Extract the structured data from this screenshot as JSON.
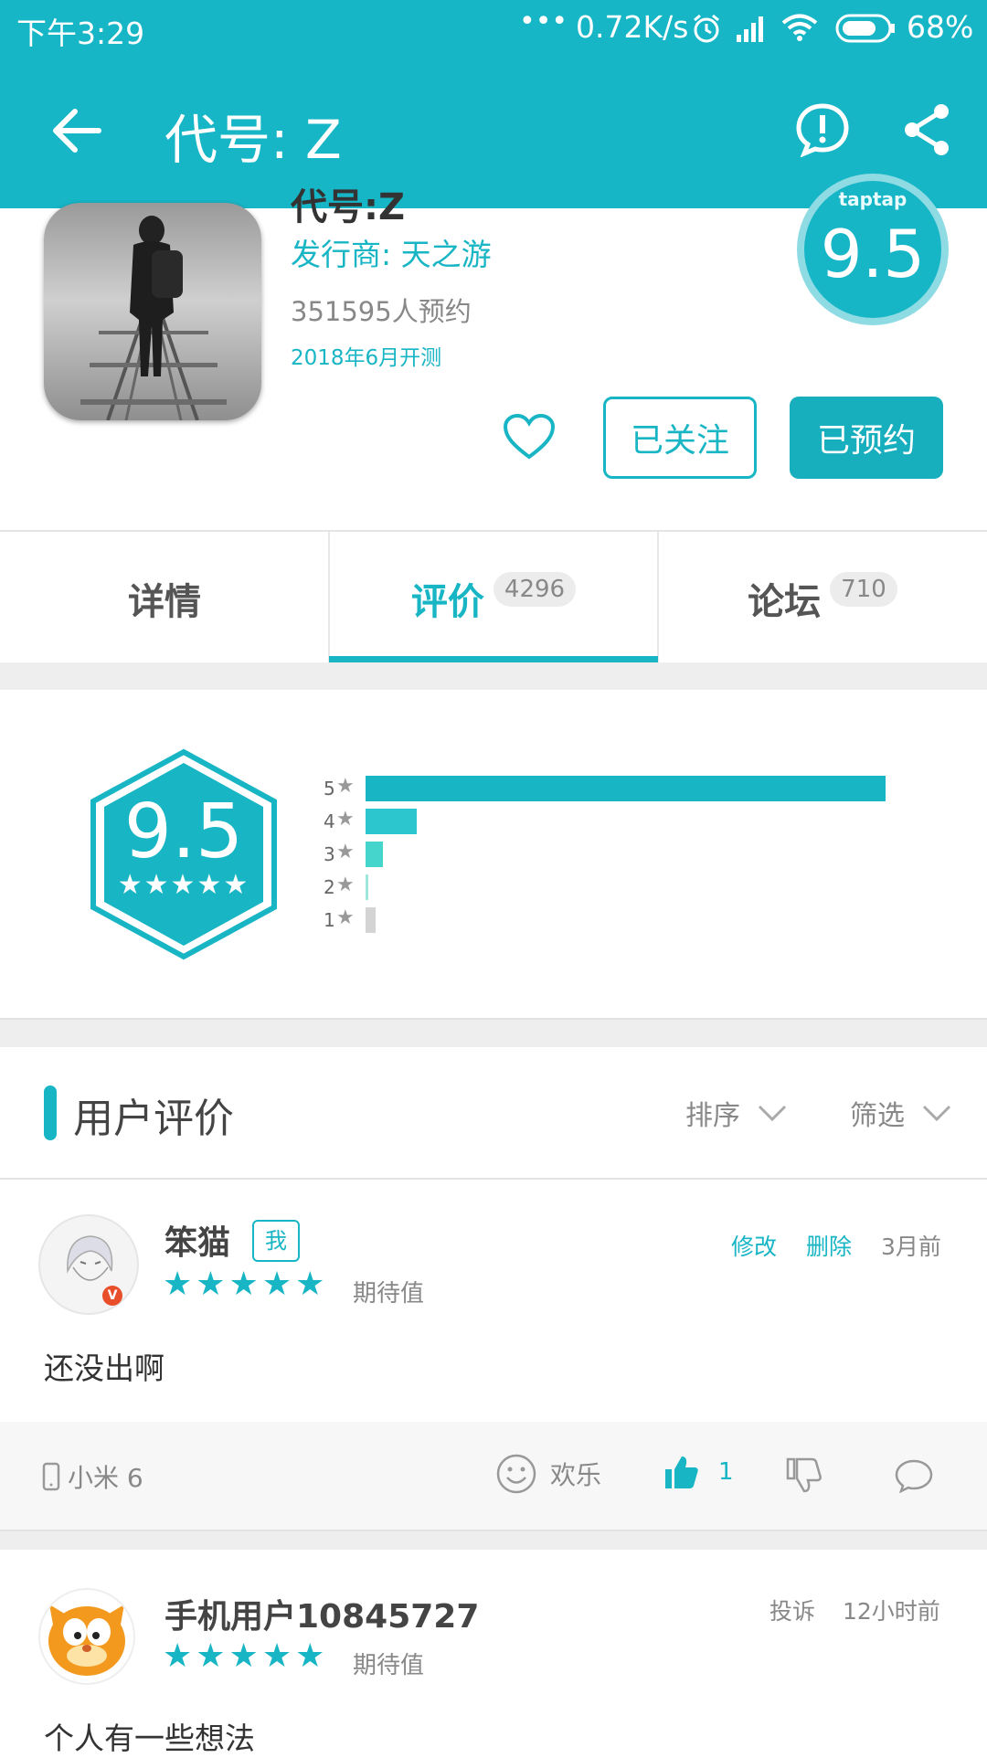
{
  "status_bar": {
    "time": "下午3:29",
    "dots": "•••",
    "speed": "0.72K/s",
    "battery": "68%"
  },
  "app_bar": {
    "title": "代号: Z",
    "icons": [
      "back-arrow-icon",
      "report-icon",
      "share-icon"
    ]
  },
  "game": {
    "name_partial": "代号:Z",
    "publisher": "发行商: 天之游",
    "reservations": "351595人预约",
    "test_date": "2018年6月开测",
    "badge_label": "taptap",
    "score": "9.5",
    "follow_label": "已关注",
    "reserved_label": "已预约"
  },
  "tabs": [
    {
      "label": "详情",
      "badge": ""
    },
    {
      "label": "评价",
      "badge": "4296"
    },
    {
      "label": "论坛",
      "badge": "710"
    }
  ],
  "rating": {
    "score": "9.5",
    "stars": "★★★★★",
    "distribution": [
      {
        "label": "5",
        "fraction": 0.91
      },
      {
        "label": "4",
        "fraction": 0.09
      },
      {
        "label": "3",
        "fraction": 0.03
      },
      {
        "label": "2",
        "fraction": 0.004
      },
      {
        "label": "1",
        "fraction": 0.018
      }
    ],
    "colors": {
      "5": "#18b5c5",
      "4": "#2cc6cf",
      "3": "#45d5cc",
      "2": "#9fe6dd",
      "1": "#d4d4d4"
    }
  },
  "reviews_section": {
    "title": "用户评价",
    "sort_label": "排序",
    "filter_label": "筛选"
  },
  "reviews": [
    {
      "user": "笨猫",
      "me_tag": "我",
      "edit": "修改",
      "delete": "删除",
      "time": "3月前",
      "stars": "★★★★★",
      "stars_label": "期待值",
      "text": "还没出啊",
      "device": "小米 6",
      "mood": "欢乐",
      "likes": "1"
    },
    {
      "user": "手机用户10845727",
      "report": "投诉",
      "time": "12小时前",
      "stars": "★★★★★",
      "stars_label": "期待值",
      "text": "个人有一些想法"
    }
  ]
}
